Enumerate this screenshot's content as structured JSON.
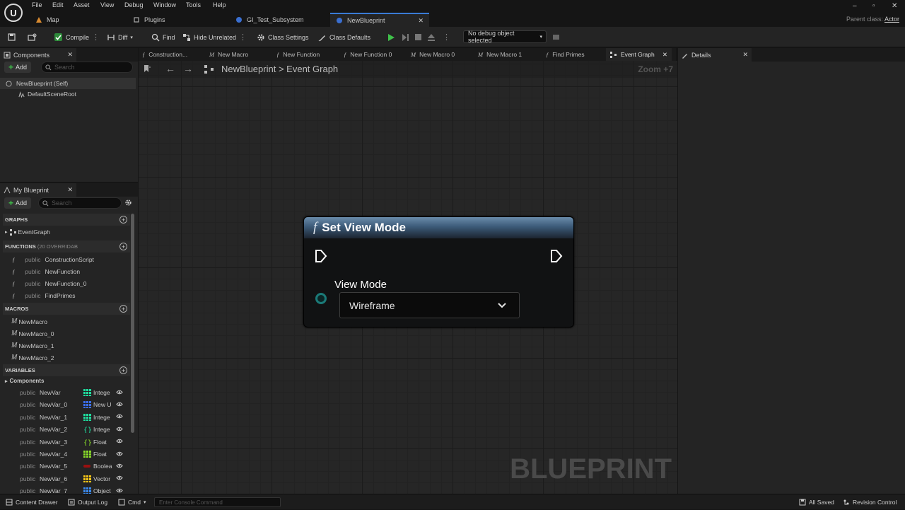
{
  "menu": [
    "File",
    "Edit",
    "Asset",
    "View",
    "Debug",
    "Window",
    "Tools",
    "Help"
  ],
  "doc_tabs": [
    {
      "label": "Map",
      "icon": "map-icon"
    },
    {
      "label": "Plugins",
      "icon": "plugins-icon"
    },
    {
      "label": "GI_Test_Subsystem",
      "icon": "blueprint-icon"
    },
    {
      "label": "NewBlueprint",
      "icon": "blueprint-icon",
      "close": "✕"
    }
  ],
  "parent_class": {
    "label": "Parent class:",
    "value": "Actor"
  },
  "toolbar": {
    "compile": "Compile",
    "diff": "Diff",
    "find": "Find",
    "hide_unrelated": "Hide Unrelated",
    "class_settings": "Class Settings",
    "class_defaults": "Class Defaults",
    "debug_object": "No debug object selected"
  },
  "components": {
    "tab": "Components",
    "close": "✕",
    "add": "Add",
    "search_placeholder": "Search",
    "tree": [
      "NewBlueprint (Self)",
      "DefaultSceneRoot"
    ]
  },
  "my_blueprint": {
    "tab": "My Blueprint",
    "close": "✕",
    "add": "Add",
    "search_placeholder": "Search",
    "graphs_header": "GRAPHS",
    "graphs": [
      "EventGraph"
    ],
    "functions_header": "FUNCTIONS",
    "functions_overrides": "(20 OVERRIDAB",
    "functions": [
      {
        "access": "public",
        "name": "ConstructionScript"
      },
      {
        "access": "public",
        "name": "NewFunction"
      },
      {
        "access": "public",
        "name": "NewFunction_0"
      },
      {
        "access": "public",
        "name": "FindPrimes"
      }
    ],
    "macros_header": "MACROS",
    "macros": [
      "NewMacro",
      "NewMacro_0",
      "NewMacro_1",
      "NewMacro_2"
    ],
    "variables_header": "VARIABLES",
    "components_label": "Components",
    "variables": [
      {
        "access": "public",
        "name": "NewVar",
        "type": "Intege",
        "color": "#1fe0a0",
        "shape": "grid"
      },
      {
        "access": "public",
        "name": "NewVar_0",
        "type": "New U",
        "color": "#3b6ff0",
        "shape": "grid"
      },
      {
        "access": "public",
        "name": "NewVar_1",
        "type": "Intege",
        "color": "#1fe0a0",
        "shape": "grid"
      },
      {
        "access": "public",
        "name": "NewVar_2",
        "type": "Intege",
        "color": "#1fe0a0",
        "shape": "brace"
      },
      {
        "access": "public",
        "name": "NewVar_3",
        "type": "Float",
        "color": "#8be02a",
        "shape": "brace"
      },
      {
        "access": "public",
        "name": "NewVar_4",
        "type": "Float",
        "color": "#8be02a",
        "shape": "grid"
      },
      {
        "access": "public",
        "name": "NewVar_5",
        "type": "Boolea",
        "color": "#9a1010",
        "shape": "pill"
      },
      {
        "access": "public",
        "name": "NewVar_6",
        "type": "Vector",
        "color": "#f5c518",
        "shape": "grid"
      },
      {
        "access": "public",
        "name": "NewVar_7",
        "type": "Object",
        "color": "#3b8bf0",
        "shape": "grid"
      }
    ]
  },
  "graph_tabs": [
    {
      "label": "Construction...",
      "icon": "function-icon"
    },
    {
      "label": "New Macro",
      "icon": "macro-icon"
    },
    {
      "label": "New Function",
      "icon": "function-icon"
    },
    {
      "label": "New Function 0",
      "icon": "function-icon"
    },
    {
      "label": "New Macro 0",
      "icon": "macro-icon"
    },
    {
      "label": "New Macro 1",
      "icon": "macro-icon"
    },
    {
      "label": "Find Primes",
      "icon": "function-icon"
    },
    {
      "label": "Event Graph",
      "icon": "graph-icon",
      "close": "✕"
    }
  ],
  "graph": {
    "breadcrumb_root": "NewBlueprint",
    "breadcrumb_sep": ">",
    "breadcrumb_leaf": "Event Graph",
    "zoom": "Zoom +7",
    "watermark": "BLUEPRINT"
  },
  "node": {
    "title": "Set View Mode",
    "func_glyph": "f",
    "param_label": "View Mode",
    "selected_value": "Wireframe",
    "header_color": "#3c5a78",
    "pin_color": "#1b7a78"
  },
  "details": {
    "tab": "Details",
    "close": "✕"
  },
  "statusbar": {
    "content_drawer": "Content Drawer",
    "output_log": "Output Log",
    "cmd": "Cmd",
    "console_placeholder": "Enter Console Command",
    "saved": "All Saved",
    "revision": "Revision Control"
  }
}
